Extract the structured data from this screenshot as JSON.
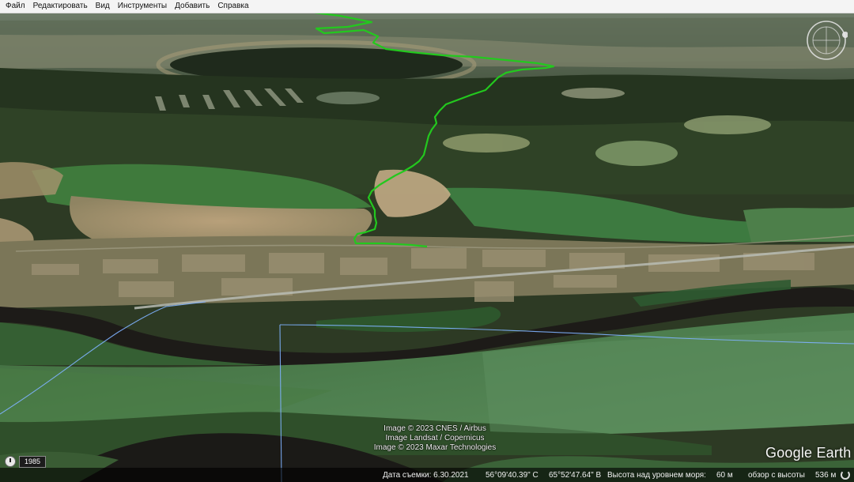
{
  "menu": [
    "Файл",
    "Редактировать",
    "Вид",
    "Инструменты",
    "Добавить",
    "Справка"
  ],
  "attribution": [
    "Image © 2023 CNES / Airbus",
    "Image Landsat / Copernicus",
    "Image © 2023 Maxar Technologies"
  ],
  "brand": "Google Earth",
  "historical_year": "1985",
  "status": {
    "capture_date": "Дата съемки: 6.30.2021",
    "latitude": "56°09'40.39\" С",
    "longitude": "65°52'47.64\" В",
    "altitude_label": "Высота над уровнем моря:",
    "altitude_value": "60 м",
    "eye_alt_label": "обзор с высоты",
    "eye_alt_value": "536 м"
  },
  "icons": {
    "compass": "compass-icon",
    "history": "clock-icon",
    "loading": "streaming-icon"
  },
  "colors": {
    "gps_track": "#23c81e",
    "boundary_line": "#7fb2ff"
  }
}
